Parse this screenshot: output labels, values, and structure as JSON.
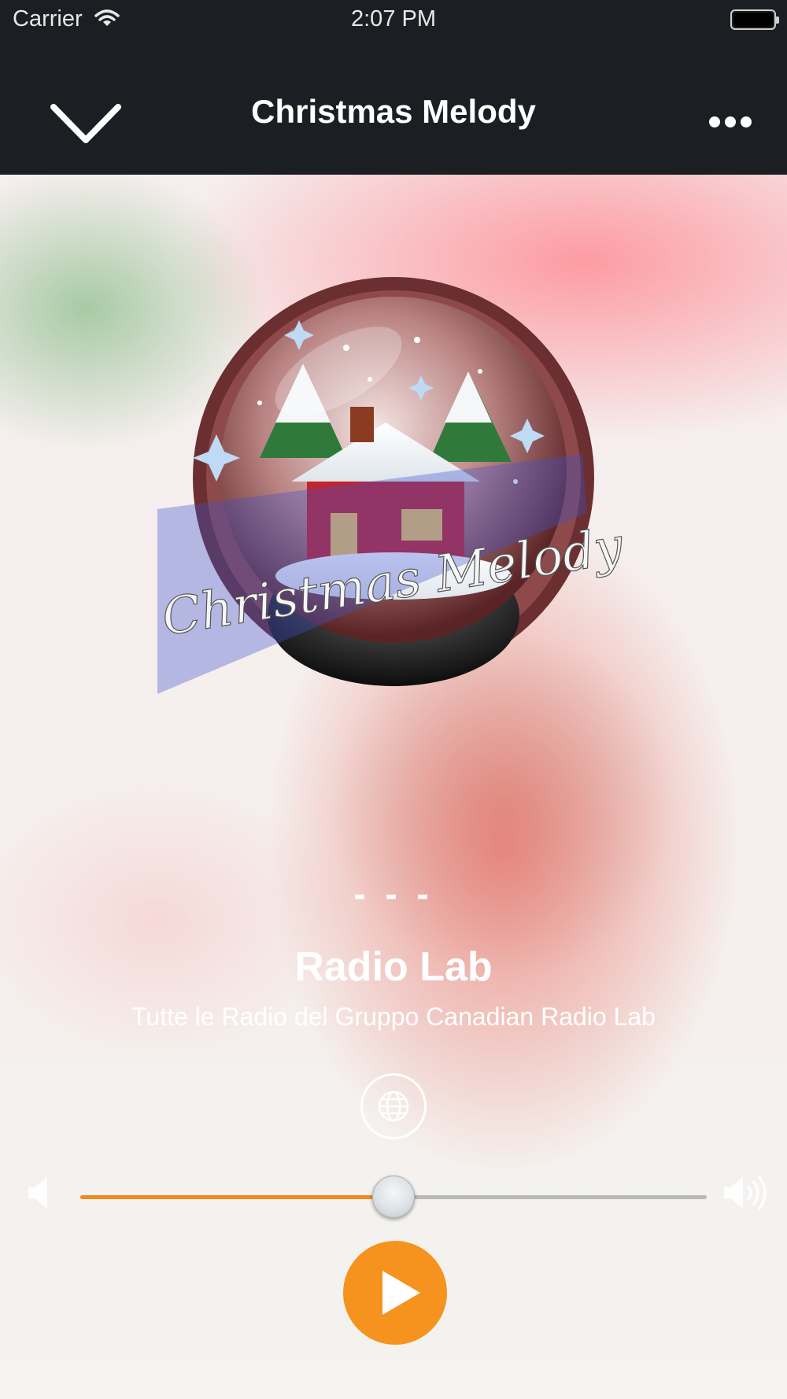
{
  "status_bar": {
    "carrier": "Carrier",
    "time": "2:07 PM"
  },
  "nav": {
    "title": "Christmas Melody",
    "back_icon": "chevron-down-icon",
    "more_icon": "more-horizontal-icon"
  },
  "artwork": {
    "logo_text": "Christmas Melody"
  },
  "track": {
    "now_playing": "- - -",
    "station_name": "Radio Lab",
    "station_description": "Tutte le Radio del Gruppo Canadian Radio Lab"
  },
  "controls": {
    "website_icon": "globe-icon",
    "volume_level": 0.5,
    "play_icon": "play-icon"
  },
  "colors": {
    "bar_background": "#1b1e22",
    "accent": "#f6921e",
    "slider_fill": "#f08a1e",
    "slider_track": "#b9b9b9"
  }
}
